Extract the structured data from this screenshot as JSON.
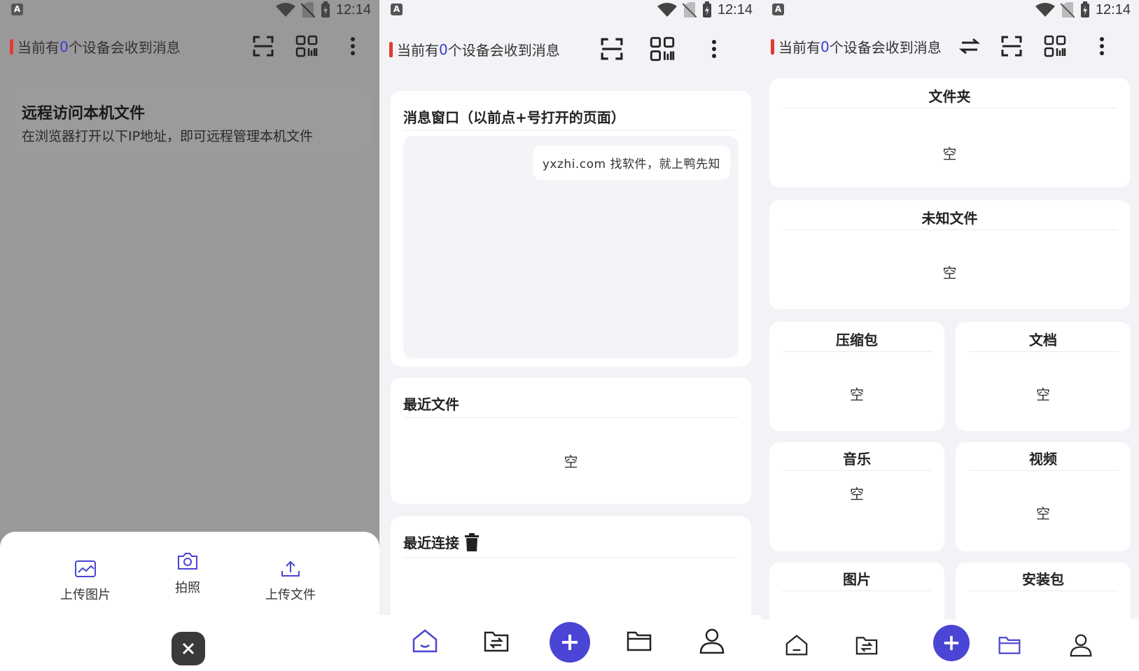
{
  "status": {
    "time": "12:14",
    "notif_letter": "A"
  },
  "header": {
    "prefix": "当前有",
    "count": "0",
    "suffix": "个设备会收到消息"
  },
  "panel1": {
    "remote_title": "远程访问本机文件",
    "remote_desc": "在浏览器打开以下IP地址，即可远程管理本机文件",
    "sheet": {
      "upload_image": "上传图片",
      "take_photo": "拍照",
      "upload_file": "上传文件"
    }
  },
  "panel2": {
    "message_window_title": "消息窗口（以前点+号打开的页面）",
    "message_bubble": "yxzhi.com 找软件，就上鸭先知",
    "recent_files_title": "最近文件",
    "recent_files_empty": "空",
    "recent_connections_title": "最近连接"
  },
  "panel3": {
    "categories": [
      {
        "name": "文件夹",
        "empty": "空"
      },
      {
        "name": "未知文件",
        "empty": "空"
      },
      {
        "name": "压缩包",
        "empty": "空"
      },
      {
        "name": "文档",
        "empty": "空"
      },
      {
        "name": "音乐",
        "empty": "空"
      },
      {
        "name": "视频",
        "empty": "空"
      },
      {
        "name": "图片"
      },
      {
        "name": "安装包"
      }
    ]
  },
  "colors": {
    "accent": "#4a45d4",
    "count": "#3b3bd9",
    "indicator": "#e53935"
  }
}
